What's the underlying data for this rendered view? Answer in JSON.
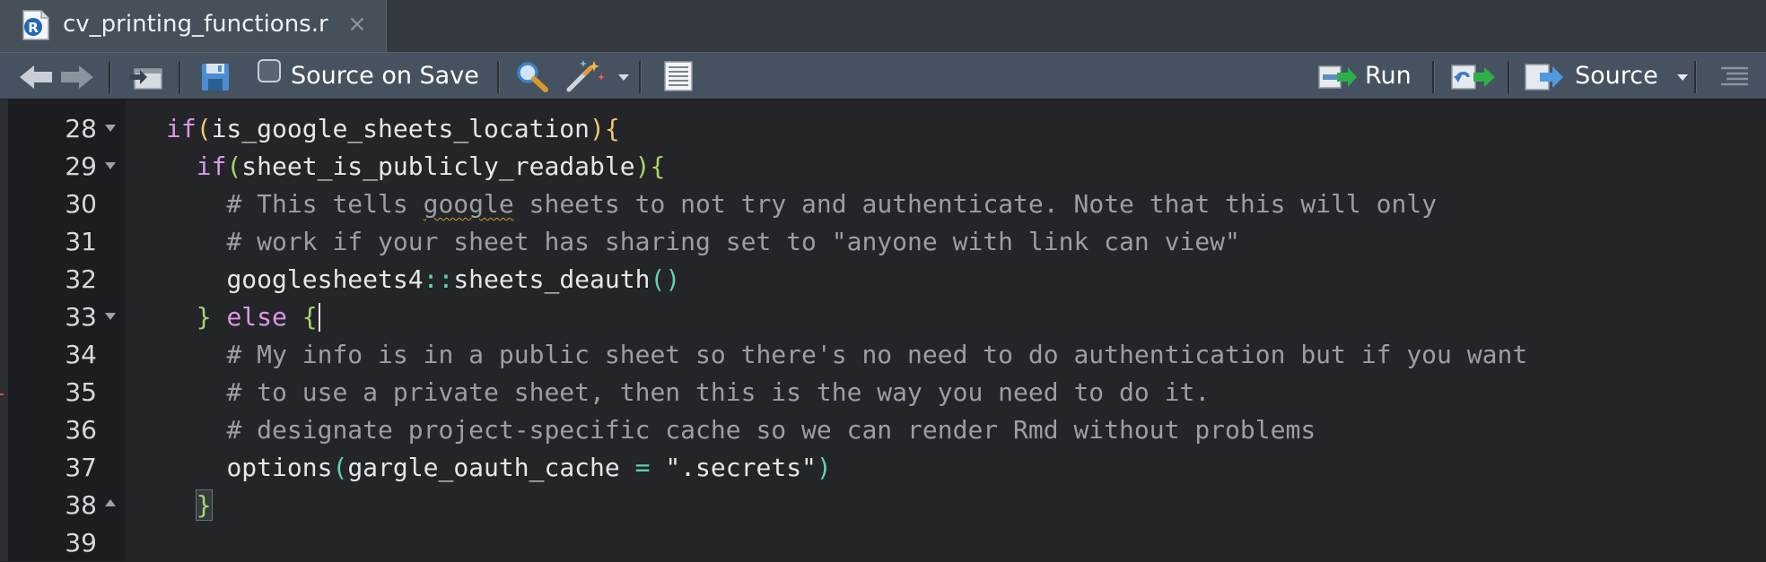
{
  "tab": {
    "title": "cv_printing_functions.r",
    "icon": "r-file-icon",
    "icon_letter": "R",
    "close": "×"
  },
  "toolbar": {
    "source_on_save_label": "Source on Save",
    "source_on_save_checked": false,
    "run_label": "Run",
    "source_label": "Source"
  },
  "colors": {
    "keyword": "#dd97e6",
    "comment": "#9b9fa4",
    "paren": "#f0c674",
    "brace": "#a9d46a",
    "operator": "#5fd3b3",
    "toolbar_bg": "#475260",
    "editor_bg": "#232528"
  },
  "editor": {
    "lines": [
      {
        "num": "28",
        "fold": "down"
      },
      {
        "num": "29",
        "fold": "down"
      },
      {
        "num": "30",
        "fold": ""
      },
      {
        "num": "31",
        "fold": ""
      },
      {
        "num": "32",
        "fold": ""
      },
      {
        "num": "33",
        "fold": "down"
      },
      {
        "num": "34",
        "fold": ""
      },
      {
        "num": "35",
        "fold": ""
      },
      {
        "num": "36",
        "fold": ""
      },
      {
        "num": "37",
        "fold": ""
      },
      {
        "num": "38",
        "fold": "up"
      },
      {
        "num": "39",
        "fold": ""
      }
    ],
    "code": {
      "l28_kw": "if",
      "l28_open": "(",
      "l28_id": "is_google_sheets_location",
      "l28_close": ")",
      "l28_brace": "{",
      "l29_kw": "if",
      "l29_open": "(",
      "l29_id": "sheet_is_publicly_readable",
      "l29_close": ")",
      "l29_brace": "{",
      "l30_a": "# This tells ",
      "l30_b": "google",
      "l30_c": " sheets to not try and authenticate. Note that this will only",
      "l31": "# work if your sheet has sharing set to \"anyone with link can view\"",
      "l32_id": "googlesheets4",
      "l32_op": "::",
      "l32_fn": "sheets_deauth",
      "l32_parens": "()",
      "l33_close": "}",
      "l33_kw": "else",
      "l33_brace": "{",
      "l34": "# My info is in a public sheet so there's no need to do authentication but if you want",
      "l35": "# to use a private sheet, then this is the way you need to do it.",
      "l36": "# designate project-specific cache so we can render Rmd without problems",
      "l37_fn": "options",
      "l37_open": "(",
      "l37_arg": "gargle_oauth_cache",
      "l37_op": "=",
      "l37_str": "\".secrets\"",
      "l37_close": ")",
      "l38_brace": "}"
    }
  }
}
